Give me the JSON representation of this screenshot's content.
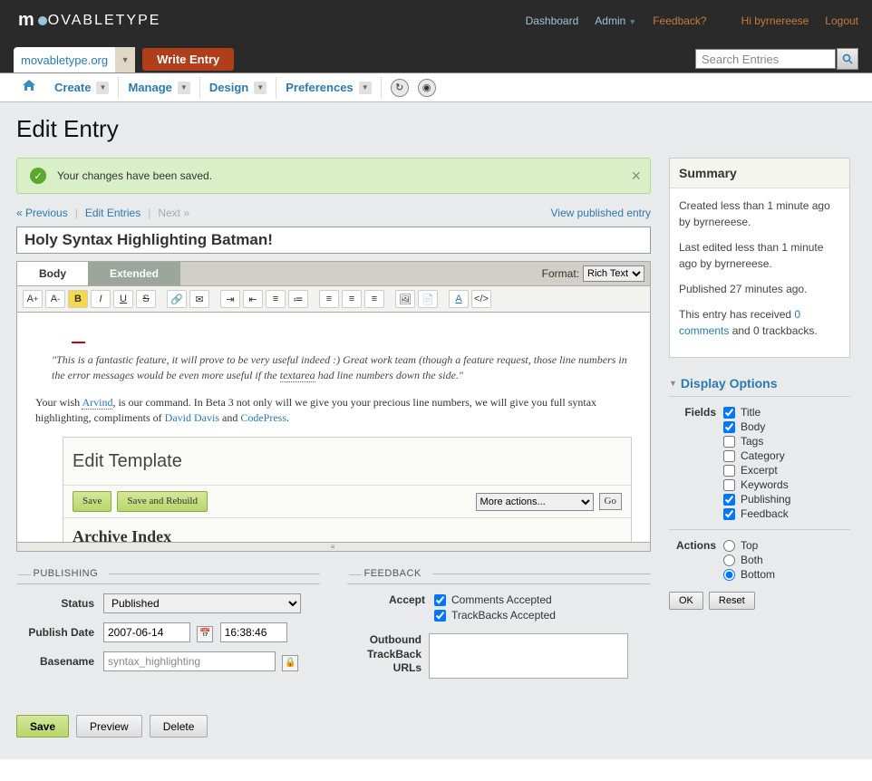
{
  "top": {
    "logo_text": "OVABLETYPE",
    "dashboard": "Dashboard",
    "admin": "Admin",
    "feedback": "Feedback?",
    "greeting": "Hi byrnereese",
    "logout": "Logout"
  },
  "nav": {
    "blog_name": "movabletype.org",
    "write_entry": "Write Entry",
    "search_placeholder": "Search Entries"
  },
  "menu": {
    "create": "Create",
    "manage": "Manage",
    "design": "Design",
    "preferences": "Preferences"
  },
  "page": {
    "title": "Edit Entry",
    "alert": "Your changes have been saved.",
    "prev": "« Previous",
    "edit_entries": "Edit Entries",
    "next": "Next »",
    "view_published": "View published entry",
    "entry_title": "Holy Syntax Highlighting Batman!"
  },
  "editor": {
    "tab_body": "Body",
    "tab_extended": "Extended",
    "format_label": "Format:",
    "format_value": "Rich Text",
    "quote": "\"This is a fantastic feature, it will prove to be very useful indeed :) Great work team (though a feature request, those line numbers in the error messages would be even more useful if the ",
    "quote_textarea": "textarea",
    "quote_end": " had line numbers down the side.\"",
    "para1_a": "Your wish ",
    "para1_link1": "Arvind",
    "para1_b": ", is our command. In Beta 3 not only will we give you your precious line numbers, we will give you full syntax highlighting, compliments of ",
    "para1_link2": "David Davis",
    "para1_c": " and ",
    "para1_link3": "CodePress",
    "para1_d": ".",
    "sb_title": "Edit Template",
    "sb_save": "Save",
    "sb_rebuild": "Save and Rebuild",
    "sb_more": "More actions...",
    "sb_go": "Go",
    "sb_h2": "Archive Index"
  },
  "publishing": {
    "legend": "PUBLISHING",
    "status_label": "Status",
    "status_value": "Published",
    "date_label": "Publish Date",
    "date_value": "2007-06-14",
    "time_value": "16:38:46",
    "basename_label": "Basename",
    "basename_value": "syntax_highlighting"
  },
  "feedback": {
    "legend": "FEEDBACK",
    "accept_label": "Accept",
    "comments": "Comments Accepted",
    "trackbacks": "TrackBacks Accepted",
    "outbound_label": "Outbound TrackBack URLs"
  },
  "actions": {
    "save": "Save",
    "preview": "Preview",
    "delete": "Delete"
  },
  "summary": {
    "heading": "Summary",
    "p1": "Created less than 1 minute ago by byrnereese.",
    "p2": "Last edited less than 1 minute ago by byrnereese.",
    "p3": "Published 27 minutes ago.",
    "p4a": "This entry has received ",
    "p4link": "0 comments",
    "p4b": " and 0 trackbacks."
  },
  "display": {
    "heading": "Display Options",
    "fields_label": "Fields",
    "fields": [
      "Title",
      "Body",
      "Tags",
      "Category",
      "Excerpt",
      "Keywords",
      "Publishing",
      "Feedback"
    ],
    "fields_checked": [
      true,
      true,
      false,
      false,
      false,
      false,
      true,
      true
    ],
    "actions_label": "Actions",
    "actions_opts": [
      "Top",
      "Both",
      "Bottom"
    ],
    "actions_selected": 2,
    "ok": "OK",
    "reset": "Reset"
  }
}
